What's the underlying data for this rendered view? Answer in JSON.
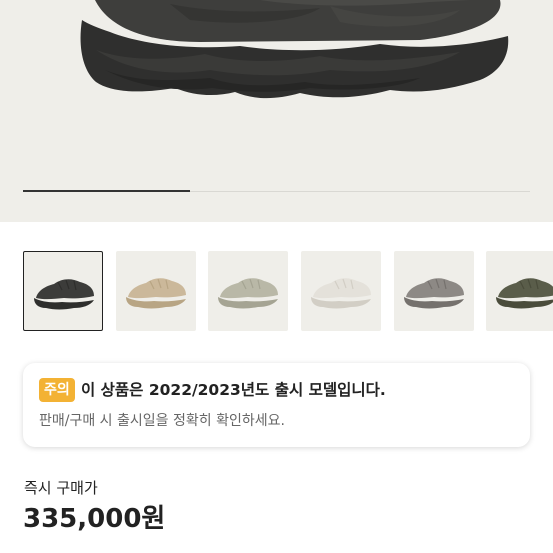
{
  "hero": {
    "image_alt": "Black YEEZY 500 sneaker",
    "slide_progress": 0.33
  },
  "thumbnails": [
    {
      "name": "black",
      "selected": true,
      "shoe_color": "#3c3c3a",
      "sole_color": "#2e2e2c"
    },
    {
      "name": "taupe",
      "selected": false,
      "shoe_color": "#cbb89a",
      "sole_color": "#b8a584"
    },
    {
      "name": "sage",
      "selected": false,
      "shoe_color": "#b9b8a7",
      "sole_color": "#a5a493"
    },
    {
      "name": "white",
      "selected": false,
      "shoe_color": "#e4e1da",
      "sole_color": "#d2cec5"
    },
    {
      "name": "grey",
      "selected": false,
      "shoe_color": "#8d8985",
      "sole_color": "#75716d"
    },
    {
      "name": "olive",
      "selected": false,
      "shoe_color": "#5a5d4a",
      "sole_color": "#4a4c3b"
    }
  ],
  "notice": {
    "badge": "주의",
    "title": "이 상품은 2022/2023년도 출시 모델입니다.",
    "description": "판매/구매 시 출시일을 정확히 확인하세요."
  },
  "price": {
    "label": "즉시 구매가",
    "value": "335,000원"
  },
  "colors": {
    "hero_bg": "#efeee9",
    "badge": "#f3b234",
    "text": "#222222",
    "subtext": "#666666"
  }
}
